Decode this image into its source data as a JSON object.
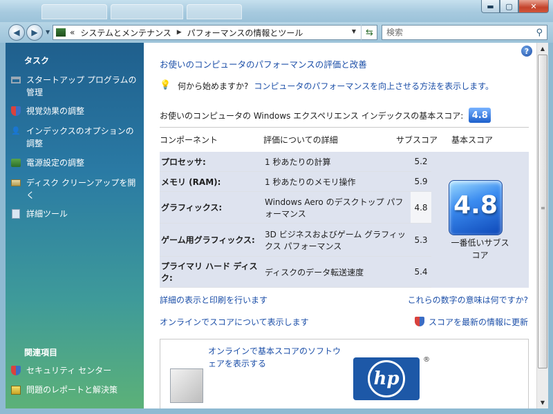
{
  "window": {
    "controls": {
      "minimize": "▬",
      "maximize": "▢",
      "close": "✕"
    }
  },
  "address": {
    "root_glyph": "«",
    "crumbs": [
      "システムとメンテナンス",
      "パフォーマンスの情報とツール"
    ],
    "search_placeholder": "検索"
  },
  "sidebar": {
    "tasks_heading": "タスク",
    "items": [
      {
        "label": "スタートアップ プログラムの管理",
        "icon": "startup-programs-icon"
      },
      {
        "label": "視覚効果の調整",
        "icon": "shield-icon"
      },
      {
        "label": "インデックスのオプションの調整",
        "icon": "index-options-icon"
      },
      {
        "label": "電源設定の調整",
        "icon": "power-options-icon"
      },
      {
        "label": "ディスク クリーンアップを開く",
        "icon": "disk-cleanup-icon"
      },
      {
        "label": "詳細ツール",
        "icon": "advanced-tools-icon"
      }
    ],
    "related_heading": "関連項目",
    "related": [
      {
        "label": "セキュリティ センター",
        "icon": "shield-icon"
      },
      {
        "label": "問題のレポートと解決策",
        "icon": "problem-reports-icon"
      }
    ]
  },
  "main": {
    "title": "お使いのコンピュータのパフォーマンスの評価と改善",
    "tip_prefix": "何から始めますか?",
    "tip_link": "コンピュータのパフォーマンスを向上させる方法を表示します。",
    "base_score_text": "お使いのコンピュータの Windows エクスペリエンス インデックスの基本スコア:",
    "base_score": "4.8",
    "table": {
      "headers": {
        "component": "コンポーネント",
        "details": "評価についての詳細",
        "subscore": "サブスコア",
        "base": "基本スコア"
      },
      "rows": [
        {
          "component": "プロセッサ:",
          "details": "1 秒あたりの計算",
          "subscore": "5.2"
        },
        {
          "component": "メモリ (RAM):",
          "details": "1 秒あたりのメモリ操作",
          "subscore": "5.9"
        },
        {
          "component": "グラフィックス:",
          "details": "Windows Aero のデスクトップ パフォーマンス",
          "subscore": "4.8"
        },
        {
          "component": "ゲーム用グラフィックス:",
          "details": "3D ビジネスおよびゲーム グラフィックス パフォーマンス",
          "subscore": "5.3"
        },
        {
          "component": "プライマリ ハード ディスク:",
          "details": "ディスクのデータ転送速度",
          "subscore": "5.4"
        }
      ],
      "lowest_subscore_caption": "一番低いサブスコア"
    },
    "links": {
      "details_print": "詳細の表示と印刷を行います",
      "what_numbers_mean": "これらの数字の意味は何ですか?",
      "online_score": "オンラインでスコアについて表示します",
      "refresh_score": "スコアを最新の情報に更新"
    },
    "promo": {
      "text": "オンラインで基本スコアのソフトウェアを表示する",
      "hp_logo": "hp",
      "hp_reg": "®"
    }
  },
  "colors": {
    "link": "#1c4fa8",
    "sidebar_top": "#1f5f8d",
    "sidebar_bottom": "#5cb178",
    "table_fill": "#dee3ef",
    "badge": "#1c5fcb"
  }
}
